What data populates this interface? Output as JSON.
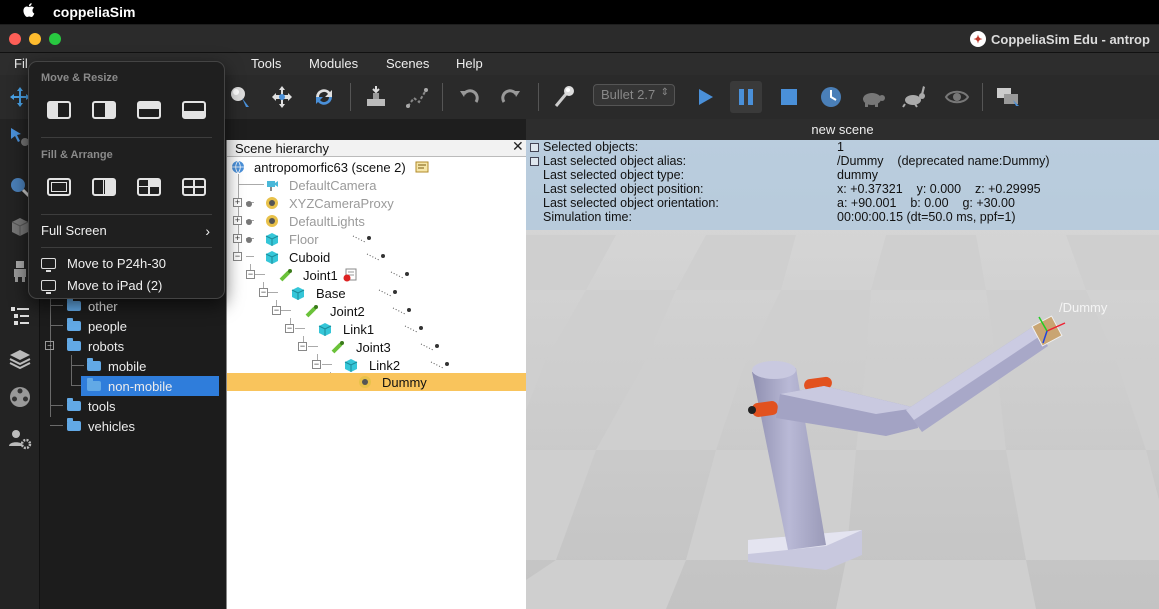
{
  "menubar": {
    "apple_icon": "apple-logo-icon",
    "app_name": "coppeliaSim"
  },
  "window": {
    "title": "CoppeliaSim Edu - antrop"
  },
  "app_menu": {
    "file": "Fil",
    "tools": "Tools",
    "modules": "Modules",
    "scenes": "Scenes",
    "help": "Help"
  },
  "toolbar": {
    "engine": "Bullet 2.7"
  },
  "popup": {
    "move_resize": "Move & Resize",
    "fill_arrange": "Fill & Arrange",
    "full_screen": "Full Screen",
    "move_to_1": "Move to P24h-30",
    "move_to_2": "Move to iPad (2)"
  },
  "browser": {
    "items": [
      "other",
      "people",
      "robots",
      "mobile",
      "non-mobile",
      "tools",
      "vehicles"
    ]
  },
  "hierarchy": {
    "title": "Scene hierarchy",
    "rows": [
      "antropomorfic63 (scene 2)",
      "DefaultCamera",
      "XYZCameraProxy",
      "DefaultLights",
      "Floor",
      "Cuboid",
      "Joint1",
      "Base",
      "Joint2",
      "Link1",
      "Joint3",
      "Link2",
      "Dummy"
    ]
  },
  "scene_tab": "new scene",
  "info": {
    "keys": [
      "Selected objects:",
      "Last selected object alias:",
      "Last selected object type:",
      "Last selected object position:",
      "Last selected object orientation:",
      "Simulation time:"
    ],
    "values": [
      "1",
      "/Dummy    (deprecated name:Dummy)",
      "dummy",
      "x: +0.37321    y: 0.000    z: +0.29995",
      "a: +90.001    b: 0.00    g: +30.00",
      "00:00:00.15 (dt=50.0 ms, ppf=1)"
    ]
  },
  "viewport": {
    "dummy_label": "/Dummy"
  }
}
